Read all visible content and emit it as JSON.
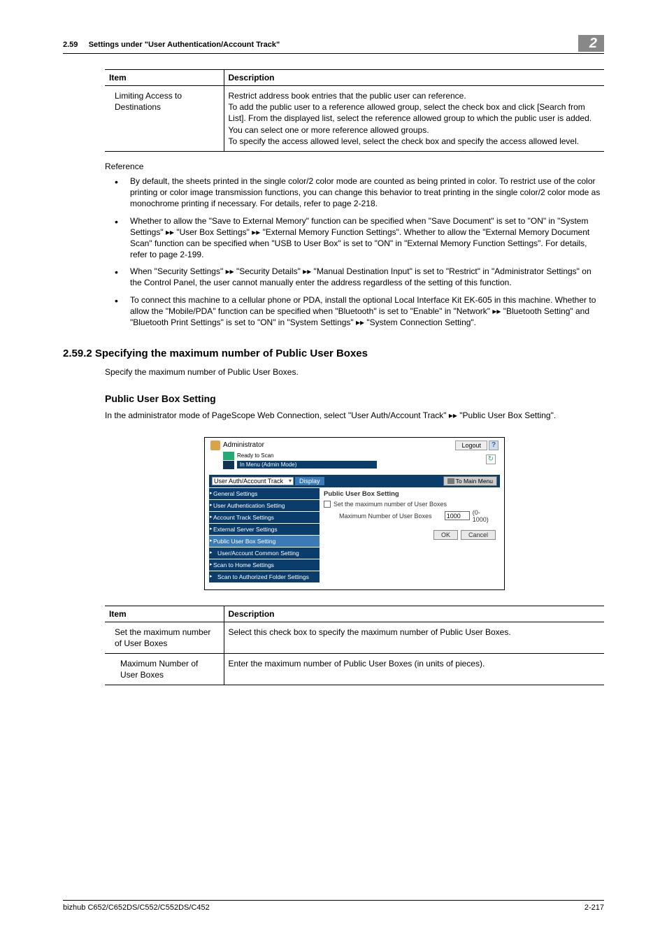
{
  "header": {
    "section_no": "2.59",
    "section_title": "Settings under \"User Authentication/Account Track\"",
    "chapter_badge": "2"
  },
  "table1": {
    "head_item": "Item",
    "head_desc": "Description",
    "row1_item": "Limiting Access to Destinations",
    "row1_desc": "Restrict address book entries that the public user can reference.\nTo add the public user to a reference allowed group, select the check box and click [Search from List]. From the displayed list, select the reference allowed group to which the public user is added. You can select one or more reference allowed groups.\nTo specify the access allowed level, select the check box and specify the access allowed level."
  },
  "reference_label": "Reference",
  "bullets": [
    "By default, the sheets printed in the single color/2 color mode are counted as being printed in color. To restrict use of the color printing or color image transmission functions, you can change this behavior to treat printing in the single color/2 color mode as monochrome printing if necessary. For details, refer to page 2-218.",
    "Whether to allow the \"Save to External Memory\" function can be specified when \"Save Document\" is set to \"ON\" in \"System Settings\" ▸▸ \"User Box Settings\" ▸▸ \"External Memory Function Settings\". Whether to allow the \"External Memory Document Scan\" function can be specified when \"USB to User Box\" is set to \"ON\" in \"External Memory Function Settings\". For details, refer to page 2-199.",
    "When \"Security Settings\" ▸▸ \"Security Details\" ▸▸ \"Manual Destination Input\" is set to \"Restrict\" in \"Administrator Settings\" on the Control Panel, the user cannot manually enter the address regardless of the setting of this function.",
    "To connect this machine to a cellular phone or PDA, install the optional Local Interface Kit EK-605 in this machine. Whether to allow the \"Mobile/PDA\" function can be specified when \"Bluetooth\" is set to \"Enable\" in \"Network\" ▸▸ \"Bluetooth Setting\" and \"Bluetooth Print Settings\" is set to \"ON\" in \"System Settings\" ▸▸ \"System Connection Setting\"."
  ],
  "section": {
    "number_title": "2.59.2    Specifying the maximum number of Public User Boxes",
    "desc": "Specify the maximum number of Public User Boxes."
  },
  "subsection": {
    "title": "Public User Box Setting",
    "desc": "In the administrator mode of PageScope Web Connection, select \"User Auth/Account Track\" ▸▸ \"Public User Box Setting\"."
  },
  "screenshot": {
    "administrator": "Administrator",
    "logout": "Logout",
    "help": "?",
    "ready": "Ready to Scan",
    "mode": "In Menu (Admin Mode)",
    "dropdown": "User Auth/Account Track",
    "display": "Display",
    "to_main": "To Main Menu",
    "side": [
      "General Settings",
      "User Authentication Setting",
      "Account Track Settings",
      "External Server Settings",
      "Public User Box Setting",
      "User/Account Common Setting",
      "Scan to Home Settings",
      "Scan to Authorized Folder Settings"
    ],
    "main_title": "Public User Box Setting",
    "cb_label": "Set the maximum number of User Boxes",
    "field_label": "Maximum Number of User Boxes",
    "field_value": "1000",
    "range": "(0-1000)",
    "ok": "OK",
    "cancel": "Cancel"
  },
  "table2": {
    "head_item": "Item",
    "head_desc": "Description",
    "r1_item": "Set the maximum number of User Boxes",
    "r1_desc": "Select this check box to specify the maximum number of Public User Boxes.",
    "r2_item": "Maximum Number of User Boxes",
    "r2_desc": "Enter the maximum number of Public User Boxes (in units of pieces)."
  },
  "footer": {
    "left": "bizhub C652/C652DS/C552/C552DS/C452",
    "right": "2-217"
  }
}
